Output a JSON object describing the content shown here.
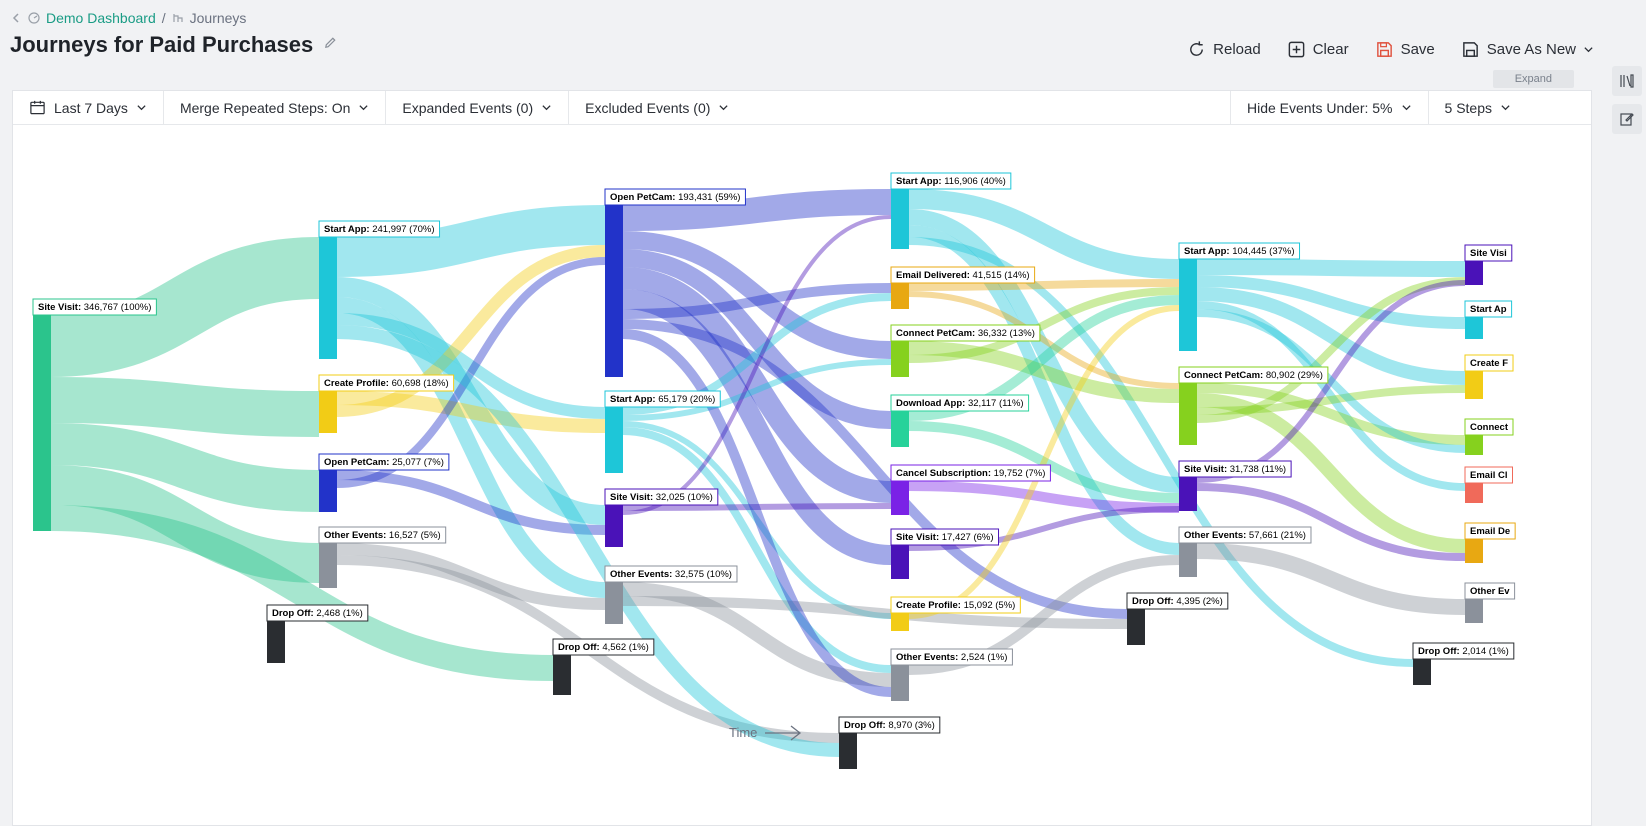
{
  "breadcrumb": {
    "parent": "Demo Dashboard",
    "separator": "/",
    "current": "Journeys"
  },
  "page_title": "Journeys for Paid Purchases",
  "toolbar": {
    "reload": "Reload",
    "clear": "Clear",
    "save": "Save",
    "save_as_new": "Save As New"
  },
  "expand_label": "Expand",
  "filters": {
    "date_range": "Last 7 Days",
    "merge": "Merge Repeated Steps: On",
    "expanded": "Expanded Events (0)",
    "excluded": "Excluded Events (0)",
    "hide_under": "Hide Events Under: 5%",
    "steps": "5 Steps"
  },
  "time_label": "Time",
  "colors": {
    "Site Visit": "#2bc48c",
    "Start App": "#1ec6d8",
    "Create Profile": "#f2cc16",
    "Open PetCam": "#2233c9",
    "Other Events": "#8b919b",
    "Drop Off": "#2a2d31",
    "Email Delivered": "#e8a812",
    "Connect PetCam": "#86d11e",
    "Download App": "#27d29a",
    "Cancel Subscription": "#7a22e6",
    "Site Visit 2": "#4a12b8",
    "Email Click": "#f06a5a"
  },
  "chart_data": {
    "type": "sankey",
    "steps": [
      {
        "nodes": [
          {
            "event": "Site Visit",
            "count": "346,767",
            "pct": "100%",
            "value": 346767
          },
          {
            "event": "Drop Off",
            "count": "2,468",
            "pct": "1%",
            "value": 2468
          }
        ]
      },
      {
        "nodes": [
          {
            "event": "Start App",
            "count": "241,997",
            "pct": "70%",
            "value": 241997
          },
          {
            "event": "Create Profile",
            "count": "60,698",
            "pct": "18%",
            "value": 60698
          },
          {
            "event": "Open PetCam",
            "count": "25,077",
            "pct": "7%",
            "value": 25077
          },
          {
            "event": "Other Events",
            "count": "16,527",
            "pct": "5%",
            "value": 16527
          },
          {
            "event": "Drop Off",
            "count": "4,562",
            "pct": "1%",
            "value": 4562
          }
        ]
      },
      {
        "nodes": [
          {
            "event": "Open PetCam",
            "count": "193,431",
            "pct": "59%",
            "value": 193431
          },
          {
            "event": "Start App",
            "count": "65,179",
            "pct": "20%",
            "value": 65179
          },
          {
            "event": "Site Visit",
            "count": "32,025",
            "pct": "10%",
            "value": 32025
          },
          {
            "event": "Other Events",
            "count": "32,575",
            "pct": "10%",
            "value": 32575
          },
          {
            "event": "Drop Off",
            "count": "8,970",
            "pct": "3%",
            "value": 8970
          }
        ]
      },
      {
        "nodes": [
          {
            "event": "Start App",
            "count": "116,906",
            "pct": "40%",
            "value": 116906
          },
          {
            "event": "Email Delivered",
            "count": "41,515",
            "pct": "14%",
            "value": 41515
          },
          {
            "event": "Connect PetCam",
            "count": "36,332",
            "pct": "13%",
            "value": 36332
          },
          {
            "event": "Download App",
            "count": "32,117",
            "pct": "11%",
            "value": 32117
          },
          {
            "event": "Cancel Subscription",
            "count": "19,752",
            "pct": "7%",
            "value": 19752
          },
          {
            "event": "Site Visit",
            "count": "17,427",
            "pct": "6%",
            "value": 17427
          },
          {
            "event": "Create Profile",
            "count": "15,092",
            "pct": "5%",
            "value": 15092
          },
          {
            "event": "Other Events",
            "count": "2,524",
            "pct": "1%",
            "value": 2524
          },
          {
            "event": "Drop Off",
            "count": "4,395",
            "pct": "2%",
            "value": 4395
          }
        ]
      },
      {
        "nodes": [
          {
            "event": "Start App",
            "count": "104,445",
            "pct": "37%",
            "value": 104445
          },
          {
            "event": "Connect PetCam",
            "count": "80,902",
            "pct": "29%",
            "value": 80902
          },
          {
            "event": "Site Visit",
            "count": "31,738",
            "pct": "11%",
            "value": 31738
          },
          {
            "event": "Other Events",
            "count": "57,661",
            "pct": "21%",
            "value": 57661
          },
          {
            "event": "Drop Off",
            "count": "2,014",
            "pct": "1%",
            "value": 2014
          }
        ]
      },
      {
        "nodes": [
          {
            "event": "Site Visi",
            "count": "",
            "pct": ""
          },
          {
            "event": "Start Ap",
            "count": "",
            "pct": ""
          },
          {
            "event": "Create F",
            "count": "",
            "pct": ""
          },
          {
            "event": "Connect",
            "count": "",
            "pct": ""
          },
          {
            "event": "Email Cl",
            "count": "",
            "pct": ""
          },
          {
            "event": "Email De",
            "count": "",
            "pct": ""
          },
          {
            "event": "Other Ev",
            "count": "",
            "pct": ""
          }
        ]
      }
    ]
  }
}
